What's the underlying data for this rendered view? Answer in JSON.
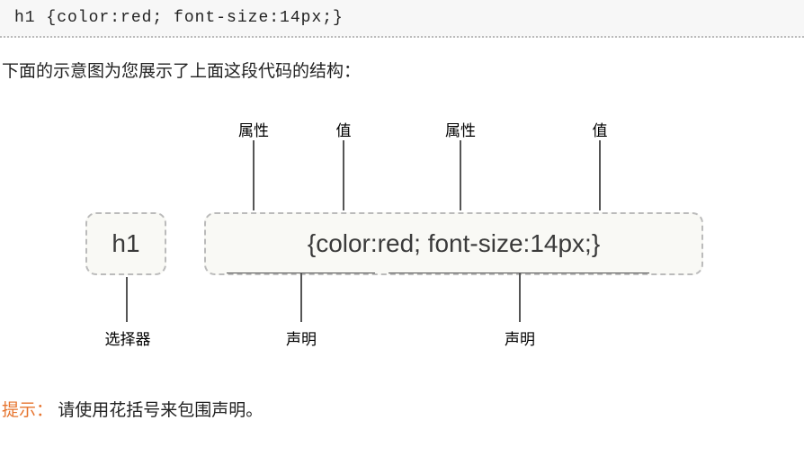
{
  "code": "h1 {color:red; font-size:14px;}",
  "intro": "下面的示意图为您展示了上面这段代码的结构：",
  "labels": {
    "property": "属性",
    "value": "值",
    "selector": "选择器",
    "declaration": "声明"
  },
  "diagram": {
    "selector_text": "h1",
    "decl_open": "{",
    "decl_close": "}",
    "prop1": "color",
    "colon": ":",
    "val1": "red",
    "semi": ";",
    "space": " ",
    "prop2": "font-size",
    "val2": "14px"
  },
  "tip": {
    "label": "提示：",
    "text": "请使用花括号来包围声明。"
  }
}
